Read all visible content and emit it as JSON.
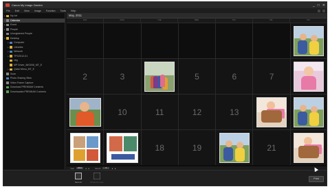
{
  "window": {
    "title": "Canon My Image Garden",
    "controls": [
      "_",
      "□",
      "✕"
    ]
  },
  "menu": {
    "items": [
      "File",
      "Edit",
      "View",
      "Image",
      "Function",
      "Tools",
      "Help"
    ]
  },
  "sidebar": {
    "items": [
      {
        "label": "My Art",
        "icon": "folder-icon",
        "arrow": "▸",
        "selected": false
      },
      {
        "label": "Calendar",
        "icon": "calendar-icon",
        "arrow": "",
        "selected": true
      },
      {
        "label": "Event",
        "icon": "event-icon",
        "arrow": "▸",
        "selected": false
      },
      {
        "label": "People",
        "icon": "people-icon",
        "arrow": "▸",
        "selected": false
      },
      {
        "label": "Unregistered People",
        "icon": "people-icon",
        "arrow": "",
        "selected": false
      },
      {
        "label": "Desktop",
        "icon": "folder-icon",
        "arrow": "▾",
        "selected": false
      },
      {
        "label": "Computer",
        "icon": "computer-icon",
        "arrow": "▸",
        "selected": false
      },
      {
        "label": "Libraries",
        "icon": "library-icon",
        "arrow": "▸",
        "selected": false
      },
      {
        "label": "Network",
        "icon": "network-icon",
        "arrow": "▸",
        "selected": false
      },
      {
        "label": "TPG2012-01",
        "icon": "folder-icon",
        "arrow": "▸",
        "selected": false
      },
      {
        "label": "vbg",
        "icon": "folder-icon",
        "arrow": "",
        "selected": false
      },
      {
        "label": "MP Driver_IMG006_MT_E",
        "icon": "folder-icon",
        "arrow": "",
        "selected": false
      },
      {
        "label": "Quick Menu_MT_E",
        "icon": "folder-icon",
        "arrow": "▸",
        "selected": false
      },
      {
        "label": "Scan",
        "icon": "scan-icon",
        "arrow": "",
        "selected": false
      },
      {
        "label": "Photo Sharing Sites",
        "icon": "share-icon",
        "arrow": "",
        "selected": false
      },
      {
        "label": "Video Frame Capture",
        "icon": "video-icon",
        "arrow": "",
        "selected": false
      },
      {
        "label": "Download PREMIUM Contents",
        "icon": "download-icon",
        "arrow": "",
        "selected": false
      },
      {
        "label": "Downloaded PREMIUM Contents",
        "icon": "download-icon",
        "arrow": "",
        "selected": false
      }
    ]
  },
  "calendar": {
    "header": "May, 2011",
    "weekdays": [
      "SUN",
      "MON",
      "TUE",
      "WED",
      "THU",
      "FRI",
      "SAT"
    ],
    "days": [
      {
        "num": "",
        "photo": ""
      },
      {
        "num": "",
        "photo": ""
      },
      {
        "num": "",
        "photo": ""
      },
      {
        "num": "",
        "photo": ""
      },
      {
        "num": "",
        "photo": ""
      },
      {
        "num": "",
        "photo": ""
      },
      {
        "num": "",
        "photo": "p-kids"
      },
      {
        "num": "2",
        "photo": ""
      },
      {
        "num": "3",
        "photo": ""
      },
      {
        "num": "",
        "photo": "p-group"
      },
      {
        "num": "5",
        "photo": ""
      },
      {
        "num": "6",
        "photo": ""
      },
      {
        "num": "7",
        "photo": ""
      },
      {
        "num": "",
        "photo": "p-baby"
      },
      {
        "num": "",
        "photo": "p-boy"
      },
      {
        "num": "10",
        "photo": ""
      },
      {
        "num": "11",
        "photo": ""
      },
      {
        "num": "12",
        "photo": ""
      },
      {
        "num": "13",
        "photo": ""
      },
      {
        "num": "",
        "photo": "p-horse"
      },
      {
        "num": "",
        "photo": "p-kids"
      },
      {
        "num": "",
        "photo": "p-card"
      },
      {
        "num": "",
        "photo": "p-cards2"
      },
      {
        "num": "18",
        "photo": ""
      },
      {
        "num": "19",
        "photo": ""
      },
      {
        "num": "",
        "photo": "p-kids"
      },
      {
        "num": "21",
        "photo": ""
      },
      {
        "num": "",
        "photo": "p-horse"
      }
    ]
  },
  "navigator": {
    "year_label": "Year",
    "year_value": "2011",
    "month_label": "Month",
    "month_value": "5",
    "prev": "◂",
    "next": "▸"
  },
  "toolbar": {
    "new_art": "New Art",
    "related_image": "Related Image",
    "print": "Print"
  }
}
